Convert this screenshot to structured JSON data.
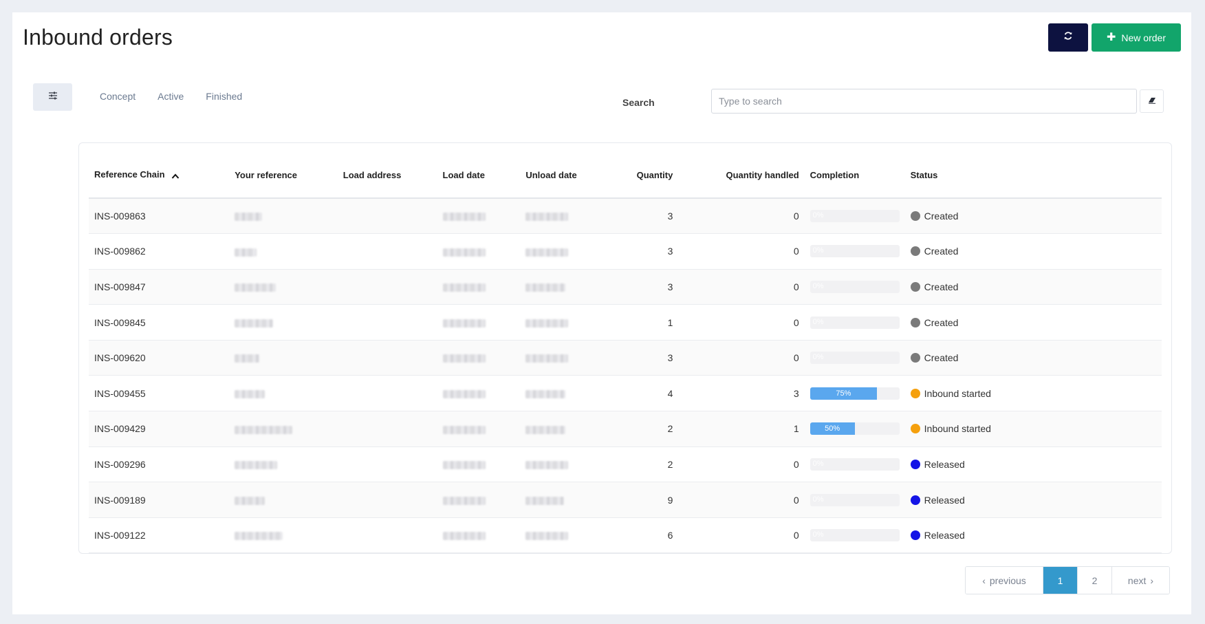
{
  "page": {
    "title": "Inbound orders"
  },
  "toolbar": {
    "refresh_icon": "refresh-icon",
    "new_order_label": "New order",
    "new_order_icon": "plus-icon"
  },
  "filters": {
    "toggle_icon": "sliders-icon",
    "tabs": [
      "Concept",
      "Active",
      "Finished"
    ]
  },
  "search": {
    "label": "Search",
    "placeholder": "Type to search",
    "value": "",
    "clear_icon": "eraser-icon"
  },
  "table": {
    "columns": {
      "ref": "Reference Chain",
      "your_ref": "Your reference",
      "load_address": "Load address",
      "load_date": "Load date",
      "unload_date": "Unload date",
      "quantity": "Quantity",
      "quantity_handled": "Quantity handled",
      "completion": "Completion",
      "status": "Status"
    },
    "sort": {
      "column": "Reference Chain",
      "direction": "ascending",
      "icon": "chevron-up-icon"
    },
    "rows": [
      {
        "ref": "INS-009863",
        "quantity": "3",
        "handled": "0",
        "completion": 0,
        "completion_label": "0%",
        "status": "Created"
      },
      {
        "ref": "INS-009862",
        "quantity": "3",
        "handled": "0",
        "completion": 0,
        "completion_label": "0%",
        "status": "Created"
      },
      {
        "ref": "INS-009847",
        "quantity": "3",
        "handled": "0",
        "completion": 0,
        "completion_label": "0%",
        "status": "Created"
      },
      {
        "ref": "INS-009845",
        "quantity": "1",
        "handled": "0",
        "completion": 0,
        "completion_label": "0%",
        "status": "Created"
      },
      {
        "ref": "INS-009620",
        "quantity": "3",
        "handled": "0",
        "completion": 0,
        "completion_label": "0%",
        "status": "Created"
      },
      {
        "ref": "INS-009455",
        "quantity": "4",
        "handled": "3",
        "completion": 75,
        "completion_label": "75%",
        "status": "Inbound started"
      },
      {
        "ref": "INS-009429",
        "quantity": "2",
        "handled": "1",
        "completion": 50,
        "completion_label": "50%",
        "status": "Inbound started"
      },
      {
        "ref": "INS-009296",
        "quantity": "2",
        "handled": "0",
        "completion": 0,
        "completion_label": "0%",
        "status": "Released"
      },
      {
        "ref": "INS-009189",
        "quantity": "9",
        "handled": "0",
        "completion": 0,
        "completion_label": "0%",
        "status": "Released"
      },
      {
        "ref": "INS-009122",
        "quantity": "6",
        "handled": "0",
        "completion": 0,
        "completion_label": "0%",
        "status": "Released"
      }
    ]
  },
  "status_colors": {
    "Created": "#7a7a7a",
    "Inbound started": "#f5a00d",
    "Released": "#1414e6"
  },
  "pagination": {
    "previous_label": "previous",
    "next_label": "next",
    "pages": [
      "1",
      "2"
    ],
    "current": "1"
  },
  "colors": {
    "primary_dark": "#0d1240",
    "accent_green": "#12a56b",
    "progress_blue": "#5aa7ee",
    "active_page": "#3499cc"
  }
}
